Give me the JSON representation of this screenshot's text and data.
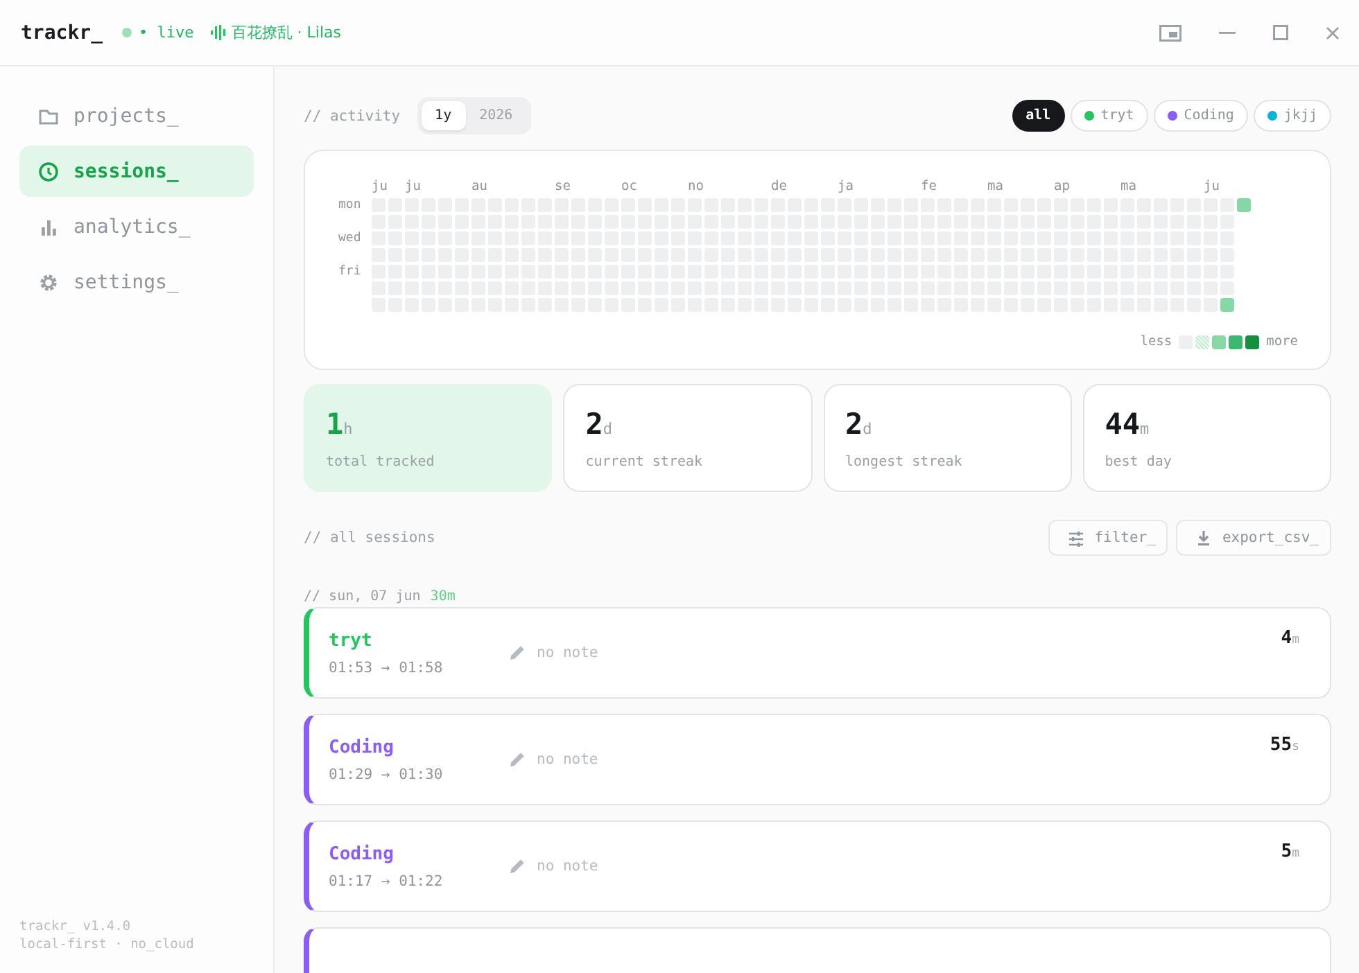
{
  "titlebar": {
    "logo": "trackr_",
    "live": {
      "on": true,
      "label": "• live"
    },
    "now_playing": "百花撩乱 · Lilas"
  },
  "sidebar": {
    "items": [
      {
        "kind": "folder",
        "label": "projects_",
        "selected": false
      },
      {
        "kind": "clock",
        "label": "sessions_",
        "selected": true
      },
      {
        "kind": "chart",
        "label": "analytics_",
        "selected": false
      },
      {
        "kind": "gear",
        "label": "settings_",
        "selected": false
      }
    ],
    "footer": [
      "trackr_  v1.4.0",
      "local-first · no_cloud"
    ]
  },
  "activity": {
    "label": "// activity",
    "ranges": [
      {
        "label": "1y",
        "selected": true
      },
      {
        "label": "2026",
        "selected": false
      }
    ],
    "filters": [
      {
        "label": "all",
        "selected": true
      },
      {
        "label": "tryt",
        "color": "#22c55e",
        "selected": false
      },
      {
        "label": "Coding",
        "color": "#8b5cf6",
        "selected": false
      },
      {
        "label": "jkjj",
        "color": "#06b6d4",
        "selected": false
      }
    ],
    "heatmap": {
      "months": [
        "ju",
        "ju",
        "au",
        "se",
        "oc",
        "no",
        "de",
        "ja",
        "fe",
        "ma",
        "ap",
        "ma",
        "ju"
      ],
      "days": [
        "mon",
        "wed",
        "fri"
      ],
      "legend": {
        "less": "less",
        "more": "more"
      }
    }
  },
  "stats": [
    {
      "value": "1",
      "unit": "h",
      "label": "total tracked",
      "selected": true
    },
    {
      "value": "2",
      "unit": "d",
      "label": "current streak",
      "selected": false
    },
    {
      "value": "2",
      "unit": "d",
      "label": "longest streak",
      "selected": false
    },
    {
      "value": "44",
      "unit": "m",
      "label": "best day",
      "selected": false
    }
  ],
  "sessions": {
    "label": "// all sessions",
    "buttons": [
      {
        "kind": "filter",
        "label": "filter_"
      },
      {
        "kind": "export",
        "label": "export_csv_"
      }
    ],
    "days": [
      {
        "label": "// sun, 07 jun",
        "total": "30m",
        "entries": [
          {
            "project": "tryt",
            "color": "#22c55e",
            "time": "01:53 → 01:58",
            "note": "no note",
            "value": "4",
            "unit": "m"
          },
          {
            "project": "Coding",
            "color": "#8b5cf6",
            "time": "01:29 → 01:30",
            "note": "no note",
            "value": "55",
            "unit": "s"
          },
          {
            "project": "Coding",
            "color": "#8b5cf6",
            "time": "01:17 → 01:22",
            "note": "no note",
            "value": "5",
            "unit": "m"
          },
          {
            "color": "#8b5cf6"
          }
        ]
      }
    ]
  }
}
